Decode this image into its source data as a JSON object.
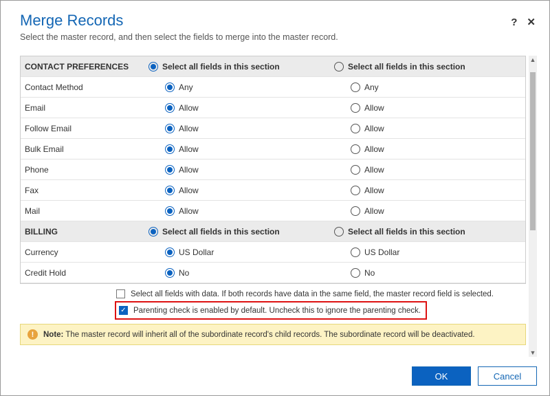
{
  "header": {
    "title": "Merge Records",
    "subtitle": "Select the master record, and then select the fields to merge into the master record.",
    "help": "?",
    "close": "✕"
  },
  "section_select_label": "Select all fields in this section",
  "sections": [
    {
      "name": "CONTACT PREFERENCES",
      "rows": [
        {
          "label": "Contact Method",
          "left": "Any",
          "right": "Any",
          "sel": "left"
        },
        {
          "label": "Email",
          "left": "Allow",
          "right": "Allow",
          "sel": "left"
        },
        {
          "label": "Follow Email",
          "left": "Allow",
          "right": "Allow",
          "sel": "left"
        },
        {
          "label": "Bulk Email",
          "left": "Allow",
          "right": "Allow",
          "sel": "left"
        },
        {
          "label": "Phone",
          "left": "Allow",
          "right": "Allow",
          "sel": "left"
        },
        {
          "label": "Fax",
          "left": "Allow",
          "right": "Allow",
          "sel": "left"
        },
        {
          "label": "Mail",
          "left": "Allow",
          "right": "Allow",
          "sel": "left"
        }
      ]
    },
    {
      "name": "BILLING",
      "rows": [
        {
          "label": "Currency",
          "left": "US Dollar",
          "right": "US Dollar",
          "sel": "left"
        },
        {
          "label": "Credit Hold",
          "left": "No",
          "right": "No",
          "sel": "left"
        }
      ]
    }
  ],
  "checks": {
    "select_all": {
      "checked": false,
      "label": "Select all fields with data. If both records have data in the same field, the master record field is selected."
    },
    "parenting": {
      "checked": true,
      "label": "Parenting check is enabled by default. Uncheck this to ignore the parenting check."
    }
  },
  "note": {
    "bold": "Note:",
    "text": " The master record will inherit all of the subordinate record's child records. The subordinate record will be deactivated."
  },
  "footer": {
    "ok": "OK",
    "cancel": "Cancel"
  }
}
